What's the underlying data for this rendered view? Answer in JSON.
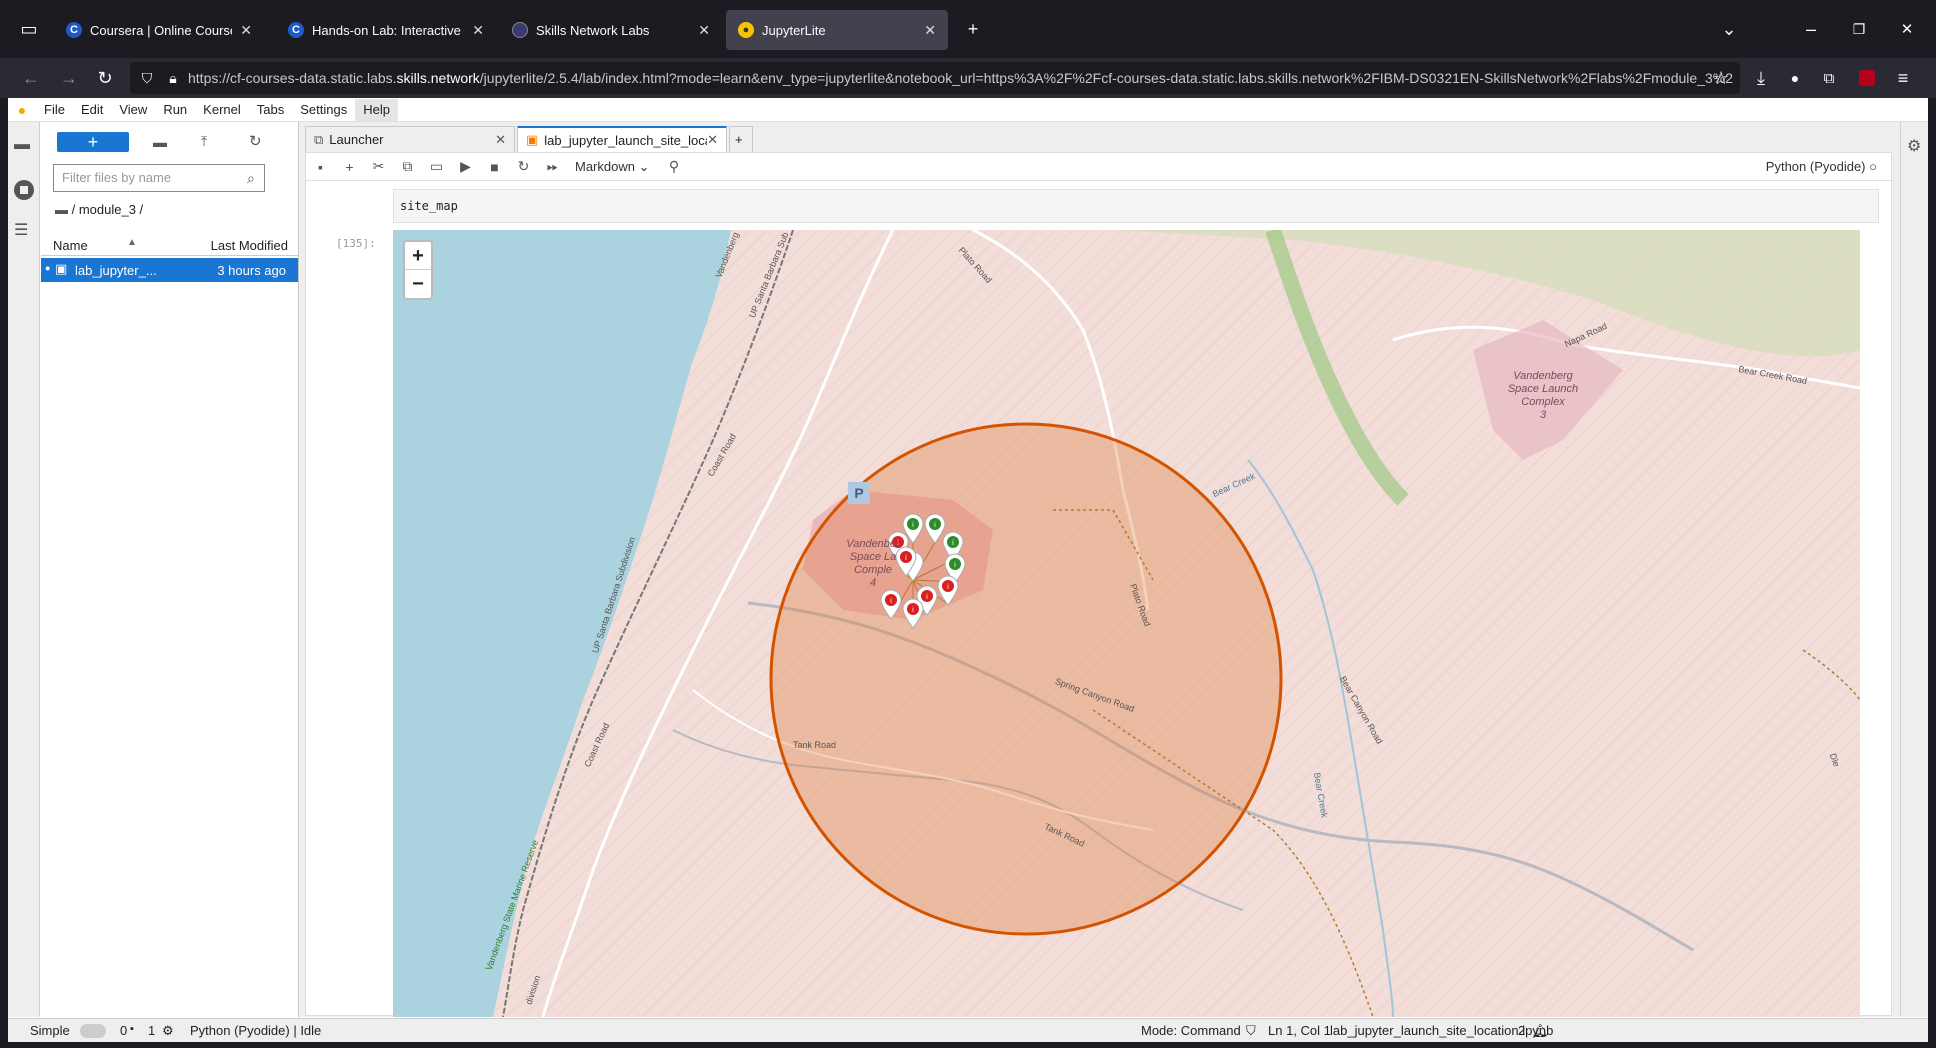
{
  "browser": {
    "tabs": [
      {
        "title": "Coursera | Online Courses From",
        "icon": "coursera-icon"
      },
      {
        "title": "Hands-on Lab: Interactive Visu",
        "icon": "coursera-icon"
      },
      {
        "title": "Skills Network Labs",
        "icon": "skills-network-icon"
      },
      {
        "title": "JupyterLite",
        "icon": "jupyter-icon",
        "active": true
      }
    ],
    "url_prefix": "https://cf-courses-data.static.labs.",
    "url_domain": "skills.network",
    "url_rest": "/jupyterlite/2.5.4/lab/index.html?mode=learn&env_type=jupyterlite&notebook_url=https%3A%2F%2Fcf-courses-data.static.labs.skills.network%2FIBM-DS0321EN-SkillsNetwork%2Flabs%2Fmodule_3%2"
  },
  "menubar": {
    "items": [
      "File",
      "Edit",
      "View",
      "Run",
      "Kernel",
      "Tabs",
      "Settings",
      "Help"
    ]
  },
  "filebrowser": {
    "filter_placeholder": "Filter files by name",
    "breadcrumb": "/ module_3 /",
    "col_name": "Name",
    "col_modified": "Last Modified",
    "file_name": "lab_jupyter_...",
    "file_modified": "3 hours ago"
  },
  "doctabs": {
    "launcher": "Launcher",
    "notebook": "lab_jupyter_launch_site_locat"
  },
  "toolbar": {
    "cell_type": "Markdown",
    "kernel": "Python (Pyodide)"
  },
  "cell": {
    "code": "site_map",
    "prompt": "[135]:"
  },
  "map": {
    "zoom_in": "+",
    "zoom_out": "−",
    "parking": "P",
    "labels": {
      "slc3": [
        "Vandenberg",
        "Space Launch",
        "Complex",
        "3"
      ],
      "slc4": [
        "Vandenber",
        "Space La",
        "Comple",
        "4"
      ],
      "plato_road": "Plato Road",
      "plato_road2": "Plato Road",
      "napa_road": "Napa Road",
      "bear_creek_road": "Bear Creek Road",
      "bear_creek": "Bear Creek",
      "bear_creek2": "Bear Creek",
      "bear_canyon_road": "Bear Canyon Road",
      "coast_road": "Coast Road",
      "coast_road2": "Coast Road",
      "spring_canyon_road": "Spring Canyon Road",
      "tank_road": "Tank Road",
      "tank_road2": "Tank Road",
      "up_santa_barbara_sub": "UP Santa Barbara Sub",
      "up_santa_barbara_subdivision": "UP Santa Barbara Subdivision",
      "vandenberg": "Vandenberg",
      "marine_reserve": "Vandenberg State Marine Reserve",
      "division": "division",
      "dle": "Dle"
    },
    "colors": {
      "ocean": "#aad3df",
      "land": "#f2ddd8",
      "circle": "#d35400",
      "success_marker": "#2e8b2e",
      "fail_marker": "#d91f1f"
    },
    "markers": {
      "success_count": 4,
      "fail_count": 7
    }
  },
  "statusbar": {
    "mode_label": "Simple",
    "terminals": "0",
    "kernels": "1",
    "kernel_status": "Python (Pyodide) | Idle",
    "mode": "Mode: Command",
    "cursor": "Ln 1, Col 1",
    "filename": "lab_jupyter_launch_site_location.ipynb",
    "notifications": "2"
  }
}
